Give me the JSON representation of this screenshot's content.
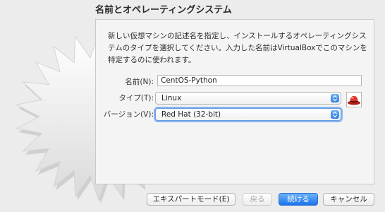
{
  "title": "名前とオペレーティングシステム",
  "description": "新しい仮想マシンの記述名を指定し、インストールするオペレーティングシステムのタイプを選択してください。入力した名前はVirtualBoxでこのマシンを特定するのに使われます。",
  "form": {
    "name_label": "名前(N):",
    "name_value": "CentOS-Python",
    "type_label": "タイプ(T):",
    "type_value": "Linux",
    "version_label": "バージョン(V):",
    "version_value": "Red Hat (32-bit)"
  },
  "buttons": {
    "expert_mode": "エキスパートモード(E)",
    "back": "戻る",
    "continue": "続ける",
    "cancel": "キャンセル"
  },
  "icons": {
    "os_icon": "redhat-os-icon",
    "popup_arrow": "updown-chevron-icon",
    "background_art": "starburst-icon"
  },
  "colors": {
    "accent": "#1c73e8",
    "background": "#ececec",
    "panel": "#f4f4f4"
  }
}
